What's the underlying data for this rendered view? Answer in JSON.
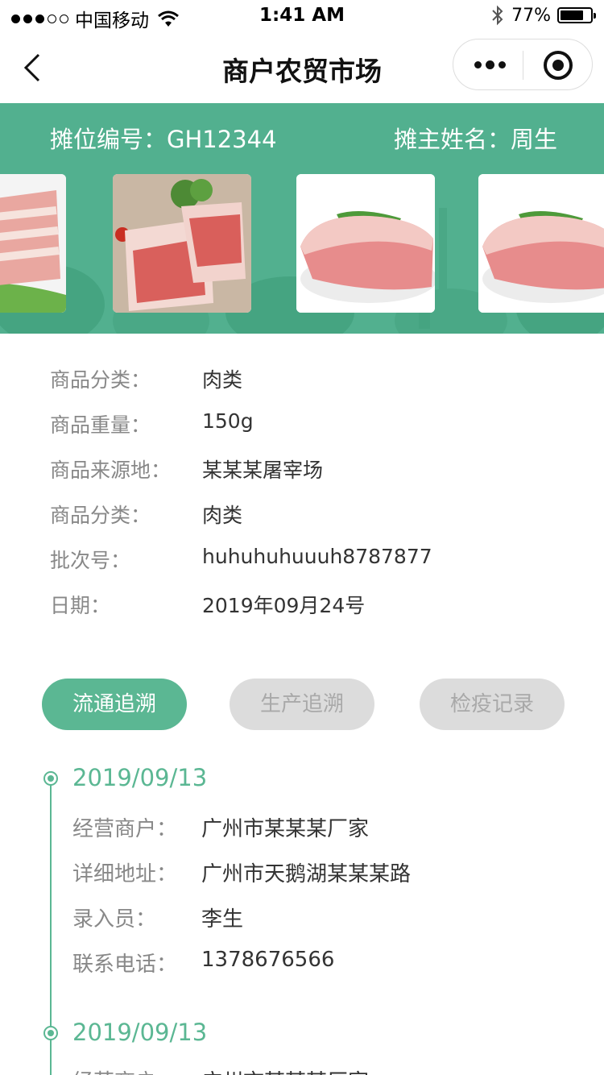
{
  "status_bar": {
    "carrier": "中国移动",
    "time": "1:41 AM",
    "battery": "77%",
    "battery_level": 0.77
  },
  "nav": {
    "title": "商户农贸市场"
  },
  "stall": {
    "stall_no": "摊位编号：GH12344",
    "owner": "摊主姓名：周生"
  },
  "product": {
    "rows": [
      {
        "label": "商品分类：",
        "value": "肉类"
      },
      {
        "label": "商品重量：",
        "value": "150g"
      },
      {
        "label": "商品来源地：",
        "value": "某某某屠宰场"
      },
      {
        "label": "商品分类：",
        "value": "肉类"
      },
      {
        "label": "批次号：",
        "value": "huhuhuhuuuh8787877"
      },
      {
        "label": "日期：",
        "value": "2019年09月24号"
      }
    ]
  },
  "tabs": [
    {
      "label": "流通追溯",
      "active": true
    },
    {
      "label": "生产追溯",
      "active": false
    },
    {
      "label": "检疫记录",
      "active": false
    }
  ],
  "timeline": [
    {
      "date": "2019/09/13",
      "rows": [
        {
          "label": "经营商户：",
          "value": "广州市某某某厂家"
        },
        {
          "label": "详细地址：",
          "value": "广州市天鹅湖某某某路"
        },
        {
          "label": "录入员：",
          "value": "李生"
        },
        {
          "label": "联系电话：",
          "value": "1378676566"
        }
      ]
    },
    {
      "date": "2019/09/13",
      "rows": [
        {
          "label": "经营商户：",
          "value": "广州市某某某厂家"
        }
      ]
    }
  ],
  "colors": {
    "accent": "#5bb793",
    "banner": "#52b08f"
  }
}
